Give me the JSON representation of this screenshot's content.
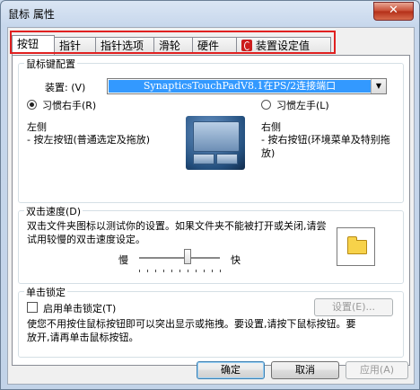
{
  "window": {
    "title": "鼠标 属性",
    "close_glyph": "✕"
  },
  "tabs": [
    {
      "label": "按钮",
      "active": true
    },
    {
      "label": "指针"
    },
    {
      "label": "指针选项"
    },
    {
      "label": "滑轮"
    },
    {
      "label": "硬件"
    },
    {
      "label": "装置设定值"
    }
  ],
  "button_config": {
    "group_title": "鼠标键配置",
    "device_label": "装置: (V)",
    "device_value": "SynapticsTouchPadV8.1在PS/2连接端口",
    "right_handed": "习惯右手(R)",
    "left_handed": "习惯左手(L)",
    "left_title": "左侧",
    "left_desc": "- 按左按钮(普通选定及拖放)",
    "right_title": "右侧",
    "right_desc": "- 按右按钮(环境菜单及特别拖放)"
  },
  "double_click": {
    "group_title": "双击速度(D)",
    "desc": "双击文件夹图标以测试你的设置。如果文件夹不能被打开或关闭,请尝试用较慢的双击速度设定。",
    "slow": "慢",
    "fast": "快",
    "speed_fraction": 0.6
  },
  "click_lock": {
    "group_title": "单击锁定",
    "checkbox_label": "启用单击锁定(T)",
    "settings_button": "设置(E)...",
    "desc": "使您不用按住鼠标按钮即可以突出显示或拖拽。要设置,请按下鼠标按钮。要放开,请再单击鼠标按钮。"
  },
  "footer": {
    "ok": "确定",
    "cancel": "取消",
    "apply": "应用(A)"
  },
  "colors": {
    "highlight_box": "#e02020",
    "selected_device_bg": "#3399ff"
  }
}
